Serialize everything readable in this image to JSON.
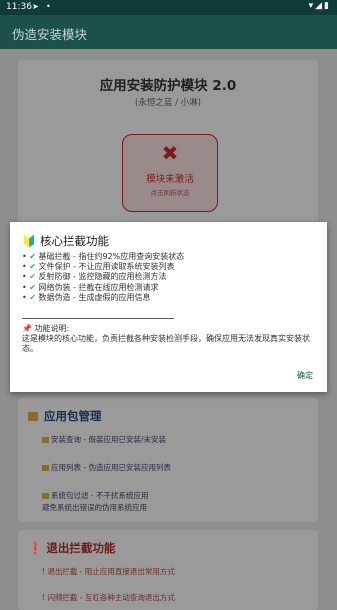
{
  "statusbar": {
    "time": "11:36",
    "icons_right": "▾◢▮"
  },
  "appbar": {
    "title": "伪造安装模块"
  },
  "module_card": {
    "title": "应用安装防护模块 2.0",
    "subtitle": "(永恒之蓝 / 小淋)",
    "status_label": "模块未激活",
    "status_hint": "点击刷新状态",
    "status_color": "#7a1a1a"
  },
  "dialog": {
    "title": "核心拦截功能",
    "features": [
      "基础拦截 - 指住约92%应用查询安装状态",
      "文件保护 - 不让应用读取系统安装列表",
      "反射防御 - 监控隐藏的应用检测方法",
      "网络伪装 - 拦截在线应用检测请求",
      "数据伪造 - 生成虚假的应用信息"
    ],
    "note_heading": "功能说明:",
    "note_body": "这是模块的核心功能，负责拦截各种安装检测手段，确保应用无法发现真实安装状态。",
    "ok_label": "确定"
  },
  "package_card": {
    "heading": "应用包管理",
    "items": [
      "安装查询 - 假装应用已安装/未安装",
      "应用列表 - 伪造应用已安装应用列表",
      "系统包过滤 - 不干扰系统应用",
      "避免系统出错误的伪用系统应用"
    ]
  },
  "exit_card": {
    "heading": "退出拦截功能",
    "items": [
      "退出拦截 - 阻止应用直接退出常用方式",
      "闪频拦截 - 互杠各种主动查询退出方式"
    ]
  }
}
